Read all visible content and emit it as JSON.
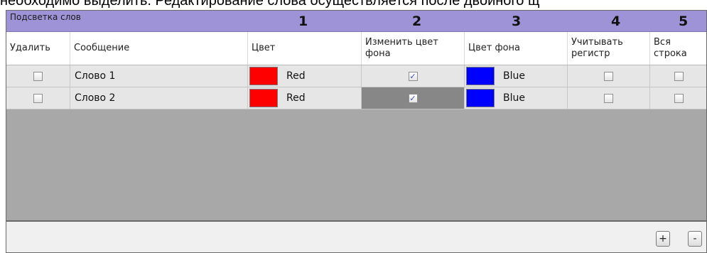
{
  "doc_text": "необходимо выделить. Редактирование слова осуществляется после двойного щ",
  "panel": {
    "title": "Подсветка слов",
    "numbers": [
      "1",
      "2",
      "3",
      "4",
      "5"
    ]
  },
  "columns": {
    "delete": "Удалить",
    "message": "Сообщение",
    "color": "Цвет",
    "change_bg_line1": "Изменить цвет",
    "change_bg_line2": "фона",
    "bg_color": "Цвет фона",
    "case_line1": "Учитывать",
    "case_line2": "регистр",
    "whole_line1": "Вся",
    "whole_line2": "строка"
  },
  "rows": [
    {
      "delete": false,
      "message": "Слово 1",
      "color_name": "Red",
      "color_hex": "#ff0000",
      "change_bg": true,
      "bg_color_name": "Blue",
      "bg_color_hex": "#0000ff",
      "match_case": false,
      "whole_line": false
    },
    {
      "delete": false,
      "message": "Слово 2",
      "color_name": "Red",
      "color_hex": "#ff0000",
      "change_bg": true,
      "bg_color_name": "Blue",
      "bg_color_hex": "#0000ff",
      "match_case": false,
      "whole_line": false
    }
  ],
  "footer": {
    "add_label": "+",
    "remove_label": "-"
  },
  "colors": {
    "title_bar": "#9e93d6",
    "grid_background": "#a8a8a8",
    "row_background": "#e6e6e6",
    "selected_cell": "#878787"
  }
}
